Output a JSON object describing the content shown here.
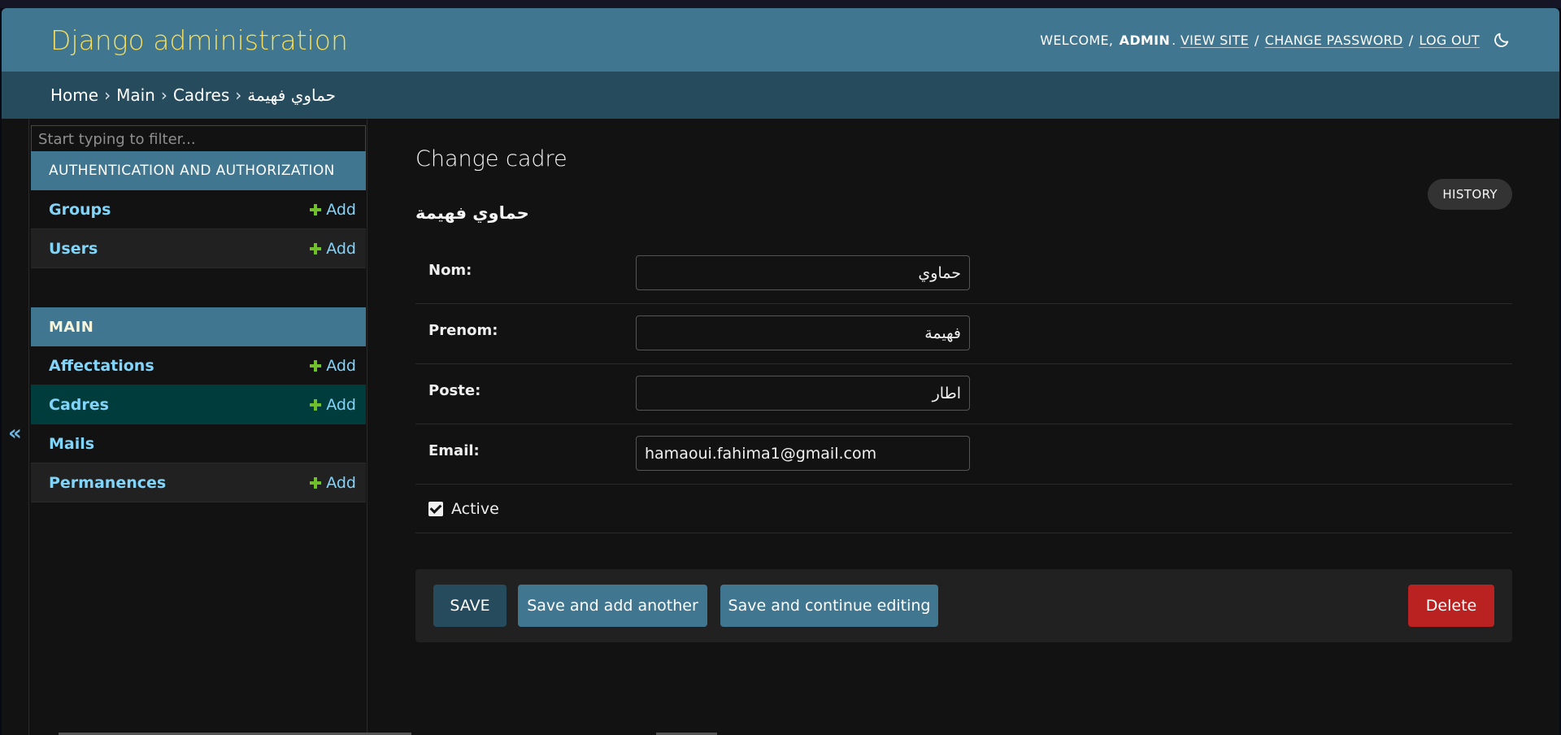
{
  "header": {
    "brand": "Django administration",
    "welcome": "WELCOME,",
    "username": "ADMIN",
    "view_site": "VIEW SITE",
    "change_password": "CHANGE PASSWORD",
    "log_out": "LOG OUT",
    "separator": "/",
    "theme_icon": "moon-icon"
  },
  "breadcrumbs": {
    "items": [
      "Home",
      "Main",
      "Cadres",
      "حماوي فهيمة"
    ],
    "separator": "›"
  },
  "sidebar": {
    "filter_placeholder": "Start typing to filter...",
    "collapse_label": "«",
    "add_label": "Add",
    "modules": [
      {
        "caption": "AUTHENTICATION AND AUTHORIZATION",
        "models": [
          {
            "name": "Groups",
            "has_add": true
          },
          {
            "name": "Users",
            "has_add": true
          }
        ]
      },
      {
        "caption": "MAIN",
        "models": [
          {
            "name": "Affectations",
            "has_add": true
          },
          {
            "name": "Cadres",
            "has_add": true,
            "selected": true
          },
          {
            "name": "Mails",
            "has_add": false
          },
          {
            "name": "Permanences",
            "has_add": true
          }
        ]
      }
    ]
  },
  "content": {
    "title": "Change cadre",
    "history_label": "HISTORY",
    "object_name": "حماوي فهيمة",
    "fields": [
      {
        "label": "Nom:",
        "value": "حماوي"
      },
      {
        "label": "Prenom:",
        "value": "فهيمة"
      },
      {
        "label": "Poste:",
        "value": "اطار"
      },
      {
        "label": "Email:",
        "value": "hamaoui.fahima1@gmail.com"
      }
    ],
    "active": {
      "label": "Active",
      "checked": true
    },
    "buttons": {
      "save": "SAVE",
      "save_add_another": "Save and add another",
      "save_continue": "Save and continue editing",
      "delete": "Delete"
    }
  },
  "colors": {
    "header_bg": "#417690",
    "breadcrumb_bg": "#264b5d",
    "brand": "#f5dd5d",
    "link": "#81d4fa",
    "add_icon": "#70bf2b",
    "selected_row": "#003c3c",
    "delete": "#ba2121"
  }
}
